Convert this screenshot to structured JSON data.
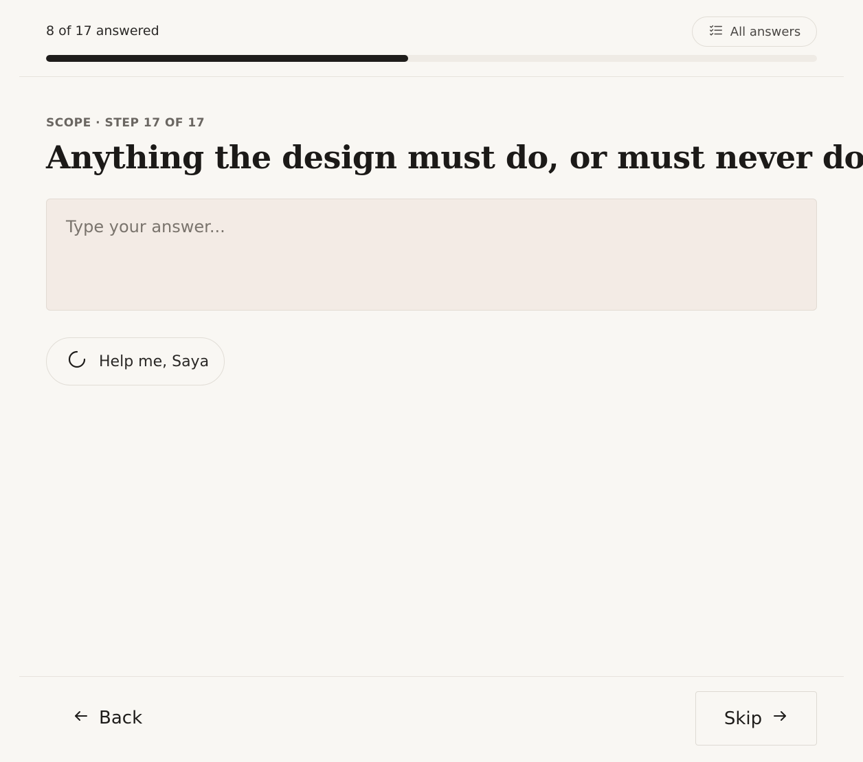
{
  "header": {
    "progress_text": "8 of 17 answered",
    "progress_fraction": 0.47,
    "all_answers_label": "All answers"
  },
  "main": {
    "step_label": "SCOPE · STEP 17 OF 17",
    "question": "Anything the design must do, or must never do?",
    "answer_placeholder": "Type your answer...",
    "answer_value": "",
    "help_label": "Help me, Saya"
  },
  "footer": {
    "back_label": "Back",
    "skip_label": "Skip"
  },
  "colors": {
    "background": "#f9f7f3",
    "progress_fill": "#1f1d1b",
    "progress_track": "#efebe5",
    "answer_bg": "#f3ebe5"
  },
  "icons": {
    "all_answers": "checklist-icon",
    "help": "spinner-icon",
    "back": "arrow-left-icon",
    "skip": "arrow-right-icon"
  }
}
